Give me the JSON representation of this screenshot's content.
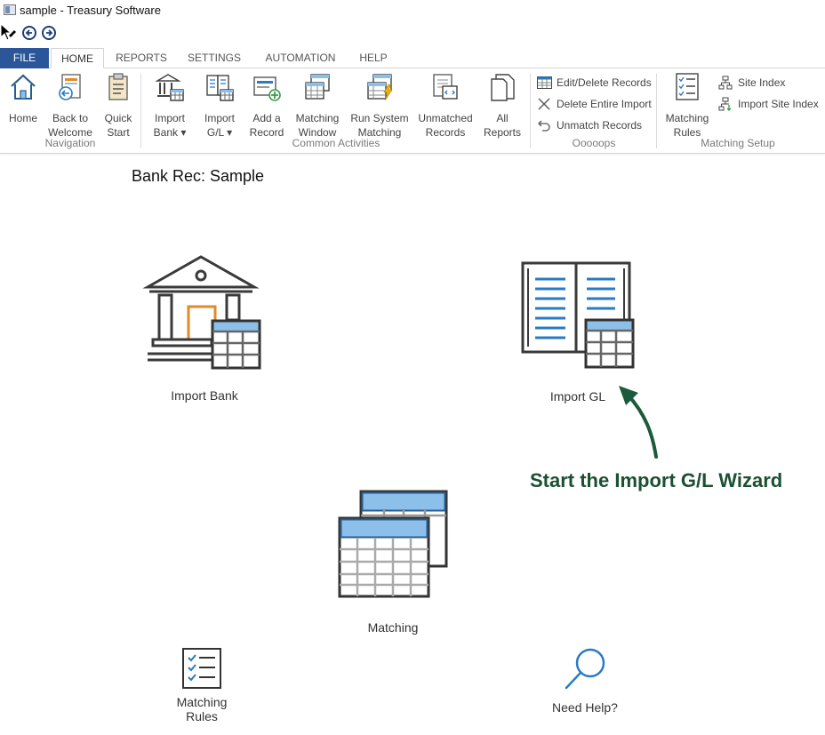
{
  "window": {
    "title": "sample - Treasury Software"
  },
  "tabs": [
    {
      "label": "FILE"
    },
    {
      "label": "HOME"
    },
    {
      "label": "REPORTS"
    },
    {
      "label": "SETTINGS"
    },
    {
      "label": "AUTOMATION"
    },
    {
      "label": "HELP"
    }
  ],
  "ribbon": {
    "navigation": {
      "label": "Navigation",
      "items": [
        "Home",
        "Back to\nWelcome",
        "Quick\nStart"
      ]
    },
    "common": {
      "label": "Common Activities",
      "items": [
        "Import\nBank ▾",
        "Import\nG/L ▾",
        "Add a\nRecord",
        "Matching\nWindow",
        "Run System\nMatching",
        "Unmatched\nRecords",
        "All\nReports"
      ]
    },
    "oops": {
      "label": "Ooooops",
      "items": [
        "Edit/Delete Records",
        "Delete Entire Import",
        "Unmatch Records"
      ]
    },
    "setup": {
      "label": "Matching Setup",
      "big": "Matching\nRules",
      "items": [
        "Site Index",
        "Import Site Index"
      ]
    }
  },
  "main": {
    "title": "Bank Rec: Sample",
    "tiles": {
      "import_bank": "Import Bank",
      "import_gl": "Import GL",
      "matching": "Matching",
      "matching_rules": "Matching\nRules",
      "need_help": "Need Help?"
    },
    "annotation": "Start the Import G/L Wizard"
  },
  "colors": {
    "file_tab": "#2b579a",
    "icon_blue": "#2a7bc4",
    "icon_light": "#8cc0ea",
    "icon_dark": "#333333",
    "accent_orange": "#e08a2e",
    "annotation_green": "#1b5032"
  }
}
